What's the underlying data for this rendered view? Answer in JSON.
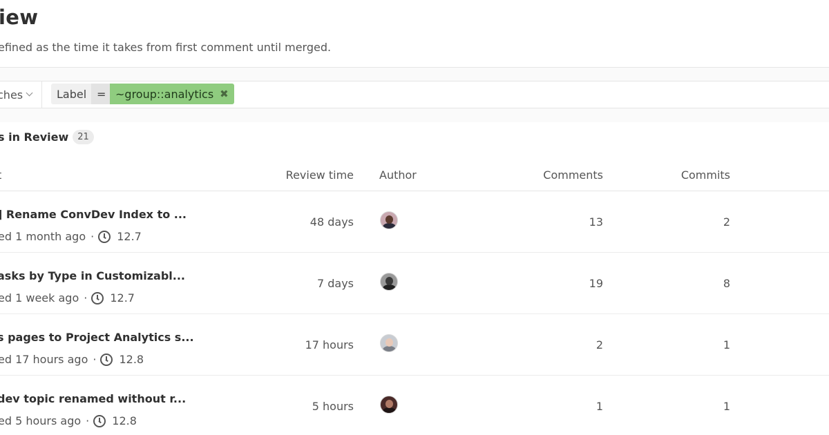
{
  "header": {
    "title": "iew",
    "description": "efined as the time it takes from first comment until merged."
  },
  "filter": {
    "branch_label": "ches",
    "token_key": "Label",
    "token_operator": "=",
    "token_value": "~group::analytics",
    "remove_glyph": "✖"
  },
  "list": {
    "heading": "s in Review",
    "count": "21",
    "columns": {
      "title": "t",
      "review_time": "Review time",
      "author": "Author",
      "comments": "Comments",
      "commits": "Commits"
    },
    "rows": [
      {
        "title": "] Rename ConvDev Index to ...",
        "opened": "ed 1 month ago",
        "milestone": "12.7",
        "review_time": "48 days",
        "comments": "13",
        "commits": "2",
        "avatar_colors": {
          "bg": "#c9a8b0",
          "head": "#5a3a2e",
          "body": "#2b2b3a"
        }
      },
      {
        "title": "asks by Type in Customizabl...",
        "opened": "ed 1 week ago",
        "milestone": "12.7",
        "review_time": "7 days",
        "comments": "19",
        "commits": "8",
        "avatar_colors": {
          "bg": "#9a9a9a",
          "head": "#3a3a3a",
          "body": "#222222"
        }
      },
      {
        "title": "s pages to Project Analytics s...",
        "opened": "ed 17 hours ago",
        "milestone": "12.8",
        "review_time": "17 hours",
        "comments": "2",
        "commits": "1",
        "avatar_colors": {
          "bg": "#c8ccd2",
          "head": "#e8c9b8",
          "body": "#7a7e86"
        }
      },
      {
        "title": "dev topic renamed without r...",
        "opened": "ed 5 hours ago",
        "milestone": "12.8",
        "review_time": "5 hours",
        "comments": "1",
        "commits": "1",
        "avatar_colors": {
          "bg": "#4a2a28",
          "head": "#b07a66",
          "body": "#1e1414"
        }
      }
    ]
  }
}
